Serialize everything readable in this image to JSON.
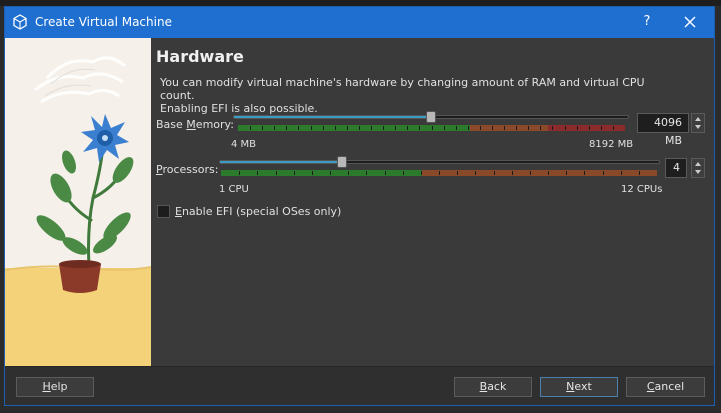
{
  "window": {
    "title": "Create Virtual Machine",
    "help_glyph": "?"
  },
  "page": {
    "heading": "Hardware",
    "description_line1": "You can modify virtual machine's hardware by changing amount of RAM and virtual CPU count.",
    "description_line2": "Enabling EFI is also possible."
  },
  "memory": {
    "label_pre": "Base ",
    "label_key": "M",
    "label_post": "emory:",
    "value": "4096 MB",
    "value_mb": 4096,
    "min_mb": 4,
    "max_mb": 8192,
    "min_label": "4 MB",
    "max_label": "8192 MB"
  },
  "processors": {
    "label_key": "P",
    "label_post": "rocessors:",
    "value": "4",
    "count": 4,
    "min": 1,
    "max": 12,
    "min_label": "1 CPU",
    "max_label": "12 CPUs"
  },
  "efi": {
    "label_key": "E",
    "label_post": "nable EFI (special OSes only)",
    "checked": false
  },
  "footer": {
    "help_key": "H",
    "help_post": "elp",
    "back_key": "B",
    "back_post": "ack",
    "next_key": "N",
    "next_post": "ext",
    "cancel_key": "C",
    "cancel_post": "ancel"
  },
  "colors": {
    "titlebar": "#1f6fd0",
    "scale_good": "#2c7a2c",
    "scale_warn": "#8a4a2a",
    "scale_bad": "#8b2b2b",
    "slider_fill": "#3c9cc5"
  }
}
